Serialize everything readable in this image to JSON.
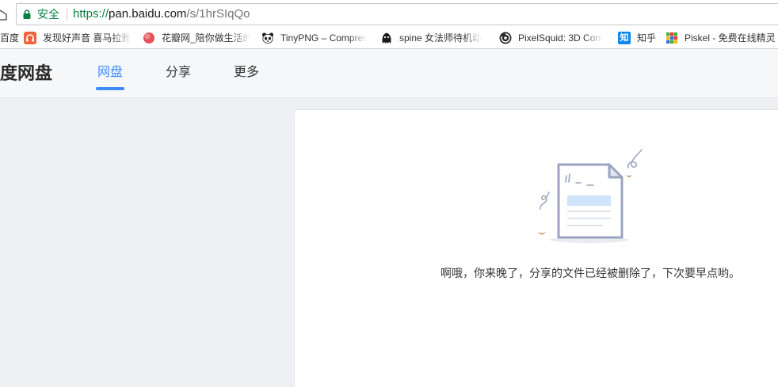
{
  "browser": {
    "home_icon": "home-icon",
    "security": {
      "icon": "lock-icon",
      "label": "安全"
    },
    "url": {
      "scheme": "https://",
      "host": "pan.baidu.com",
      "path": "/s/1hrSIqQo"
    },
    "bookmarks": [
      {
        "label": "百度"
      },
      {
        "label": "发现好声音 喜马拉雅",
        "icon": "ximalaya-icon"
      },
      {
        "label": "花瓣网_陪你做生活的",
        "icon": "huaban-icon"
      },
      {
        "label": "TinyPNG – Compres",
        "icon": "tinypng-panda-icon"
      },
      {
        "label": "spine 女法师待机动",
        "icon": "spine-icon"
      },
      {
        "label": "PixelSquid: 3D Cont",
        "icon": "pixelsquid-icon"
      },
      {
        "label": "知乎",
        "icon": "zhihu-icon",
        "icon_text": "知"
      },
      {
        "label": "Piskel - 免费在线精灵",
        "icon": "piskel-icon"
      }
    ]
  },
  "header": {
    "logo_text": "度网盘",
    "tabs": [
      {
        "label": "网盘",
        "active": true
      },
      {
        "label": "分享",
        "active": false
      },
      {
        "label": "更多",
        "active": false
      }
    ]
  },
  "main": {
    "illustration": "deleted-file-icon",
    "message": "啊哦，你来晚了，分享的文件已经被删除了，下次要早点哟。"
  },
  "colors": {
    "accent": "#3b8cff",
    "secure": "#0b8043",
    "header_bg": "#f6f7f9",
    "page_bg": "#eef0f3"
  }
}
